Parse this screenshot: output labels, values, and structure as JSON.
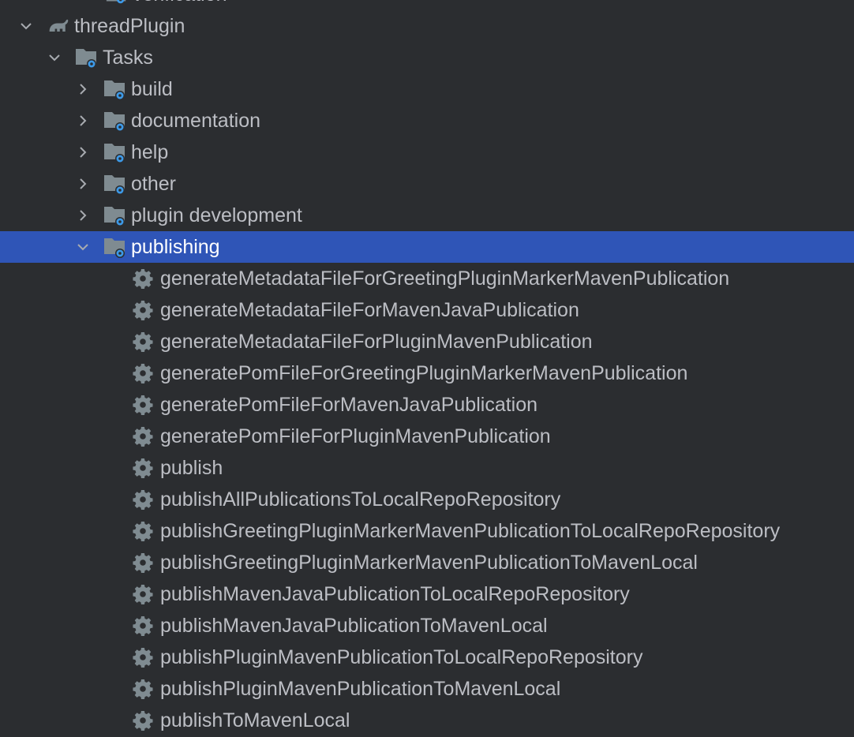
{
  "colors": {
    "background": "#2b2d30",
    "selection": "#2f55b7",
    "text": "#bcbec4",
    "icon_gray": "#7f8b91",
    "gear_blue": "#3d9ae8"
  },
  "tree": {
    "partial_top": {
      "label": "verification",
      "icon": "folder-gear-icon"
    },
    "project": {
      "label": "threadPlugin",
      "icon": "gradle-elephant-icon",
      "expanded": true
    },
    "tasks_group": {
      "label": "Tasks",
      "icon": "folder-gear-icon",
      "expanded": true
    },
    "categories": [
      {
        "label": "build",
        "expanded": false
      },
      {
        "label": "documentation",
        "expanded": false
      },
      {
        "label": "help",
        "expanded": false
      },
      {
        "label": "other",
        "expanded": false
      },
      {
        "label": "plugin development",
        "expanded": false
      },
      {
        "label": "publishing",
        "expanded": true,
        "selected": true
      }
    ],
    "publishing_tasks": [
      "generateMetadataFileForGreetingPluginMarkerMavenPublication",
      "generateMetadataFileForMavenJavaPublication",
      "generateMetadataFileForPluginMavenPublication",
      "generatePomFileForGreetingPluginMarkerMavenPublication",
      "generatePomFileForMavenJavaPublication",
      "generatePomFileForPluginMavenPublication",
      "publish",
      "publishAllPublicationsToLocalRepoRepository",
      "publishGreetingPluginMarkerMavenPublicationToLocalRepoRepository",
      "publishGreetingPluginMarkerMavenPublicationToMavenLocal",
      "publishMavenJavaPublicationToLocalRepoRepository",
      "publishMavenJavaPublicationToMavenLocal",
      "publishPluginMavenPublicationToLocalRepoRepository",
      "publishPluginMavenPublicationToMavenLocal",
      "publishToMavenLocal"
    ]
  }
}
